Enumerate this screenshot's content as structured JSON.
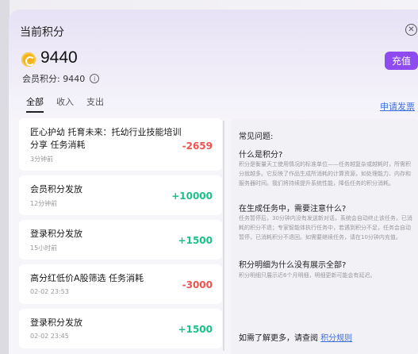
{
  "header": {
    "title": "当前积分",
    "points": "9440",
    "member_points": "会员积分: 9440",
    "recharge_label": "充值"
  },
  "tabs": [
    "全部",
    "收入",
    "支出"
  ],
  "apply_link": "申请发票",
  "records": [
    {
      "name": "匠心护幼 托育未来：托幼行业技能培训分享 任务消耗",
      "time": "3分钟前",
      "amount": "-2659",
      "sign": "neg"
    },
    {
      "name": "会员积分发放",
      "time": "12分钟前",
      "amount": "+10000",
      "sign": "pos"
    },
    {
      "name": "登录积分发放",
      "time": "15小时前",
      "amount": "+1500",
      "sign": "pos"
    },
    {
      "name": "高分红低价A股筛选 任务消耗",
      "time": "02-02 23:53",
      "amount": "-3000",
      "sign": "neg"
    },
    {
      "name": "登录积分发放",
      "time": "02-02 23:45",
      "amount": "+1500",
      "sign": "pos"
    }
  ],
  "faq": {
    "title": "常见问题:",
    "q1": "什么是积分?",
    "a1": "积分是衡量天工使用情况的标准单位——任务越复杂或越耗时，所需积分就越多。它反映了作品生成所消耗的计算资源，如处理能力、内存和服务器时间。我们将持续提升系统性能，降低任务的积分消耗。",
    "q2": "在生成任务中，需要注意什么?",
    "a2": "任务暂停后，30分钟内没有发送新对话，系统会自动终止该任务，已消耗的积分不退；专家智能体执行任务中，若遇到积分不足，任务会自动暂停，已消耗积分不退回。如需要继续任务，请在10分钟内充值。",
    "q3": "积分明细为什么没有展示全部?",
    "a3": "积分明细只展示近6个月明细，明细更新可能会有延迟。",
    "footer_prefix": "如需了解更多，请查阅",
    "footer_link": "积分规则"
  }
}
